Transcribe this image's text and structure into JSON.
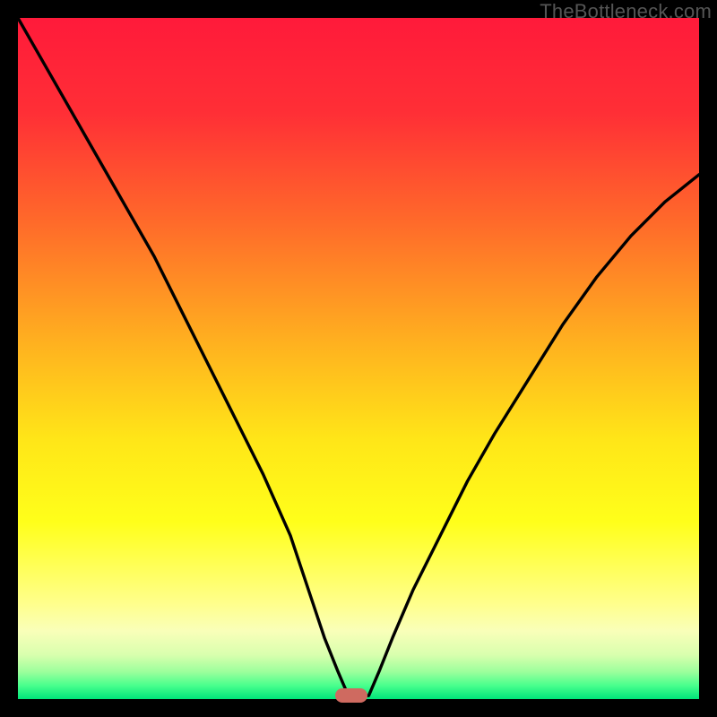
{
  "credit": "TheBottleneck.com",
  "marker": {
    "x_pct": 49,
    "y_pct": 99.5,
    "color": "#cf6a60"
  },
  "gradient_stops": [
    {
      "pct": 0,
      "color": "#ff1a3a"
    },
    {
      "pct": 14,
      "color": "#ff2f36"
    },
    {
      "pct": 30,
      "color": "#ff6a2a"
    },
    {
      "pct": 48,
      "color": "#ffb21f"
    },
    {
      "pct": 62,
      "color": "#ffe618"
    },
    {
      "pct": 74,
      "color": "#ffff1a"
    },
    {
      "pct": 86,
      "color": "#ffff8c"
    },
    {
      "pct": 90,
      "color": "#f9ffb9"
    },
    {
      "pct": 93.5,
      "color": "#d9ffae"
    },
    {
      "pct": 96,
      "color": "#9cff9c"
    },
    {
      "pct": 98,
      "color": "#49ff8d"
    },
    {
      "pct": 100,
      "color": "#00e57a"
    }
  ],
  "chart_data": {
    "type": "line",
    "title": "",
    "xlabel": "",
    "ylabel": "",
    "xlim": [
      0,
      100
    ],
    "ylim": [
      0,
      100
    ],
    "grid": false,
    "legend": false,
    "series": [
      {
        "name": "bottleneck_curve",
        "x": [
          0,
          4,
          8,
          12,
          16,
          20,
          24,
          28,
          32,
          36,
          40,
          43,
          45,
          47,
          48.5,
          51.5,
          53,
          55,
          58,
          62,
          66,
          70,
          75,
          80,
          85,
          90,
          95,
          100
        ],
        "y": [
          100,
          93,
          86,
          79,
          72,
          65,
          57,
          49,
          41,
          33,
          24,
          15,
          9,
          4,
          0.5,
          0.5,
          4,
          9,
          16,
          24,
          32,
          39,
          47,
          55,
          62,
          68,
          73,
          77
        ]
      }
    ],
    "annotations": [
      {
        "type": "marker",
        "shape": "pill",
        "x": 49,
        "y": 0.5,
        "color": "#cf6a60"
      }
    ],
    "background": "vertical_gradient_red_to_green"
  }
}
